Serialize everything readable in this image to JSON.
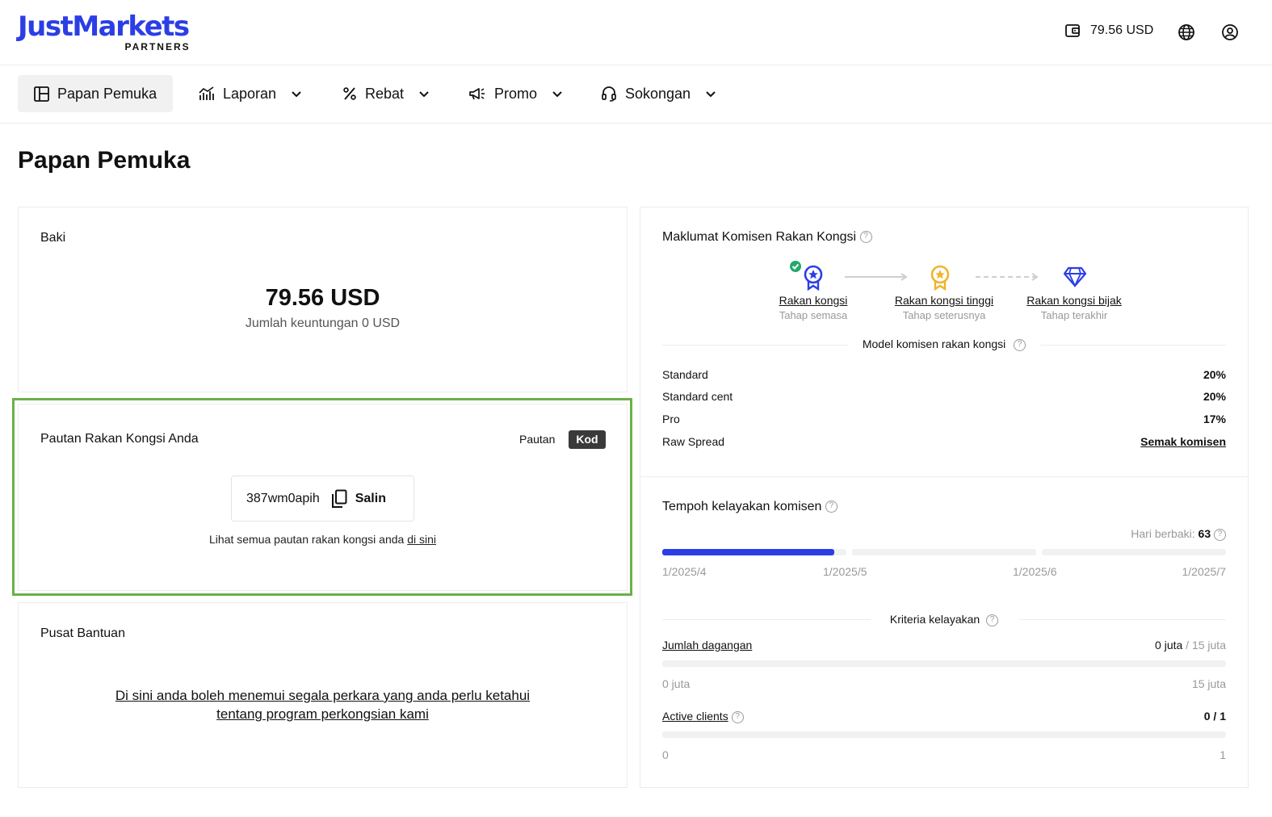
{
  "header": {
    "logo_main": "JustMarkets",
    "logo_sub": "PARTNERS",
    "wallet_balance": "79.56 USD",
    "icons": [
      "wallet-icon",
      "globe-icon",
      "user-icon"
    ]
  },
  "nav": {
    "items": [
      {
        "label": "Papan Pemuka",
        "icon": "dashboard-icon",
        "active": true
      },
      {
        "label": "Laporan",
        "icon": "chart-icon",
        "dropdown": true
      },
      {
        "label": "Rebat",
        "icon": "percent-icon",
        "dropdown": true
      },
      {
        "label": "Promo",
        "icon": "megaphone-icon",
        "dropdown": true
      },
      {
        "label": "Sokongan",
        "icon": "headset-icon",
        "dropdown": true
      }
    ]
  },
  "page_title": "Papan Pemuka",
  "balance": {
    "title": "Baki",
    "amount": "79.56 USD",
    "subtitle": "Jumlah keuntungan 0 USD"
  },
  "partner_link": {
    "title": "Pautan Rakan Kongsi Anda",
    "toggle_link": "Pautan",
    "toggle_code": "Kod",
    "code": "387wm0apih",
    "copy_label": "Salin",
    "see_all_text": "Lihat semua pautan rakan kongsi anda",
    "see_all_link": "di sini"
  },
  "help_center": {
    "title": "Pusat Bantuan",
    "line1": "Di sini anda boleh menemui segala perkara yang anda perlu ketahui",
    "line2": "tentang program perkongsian kami"
  },
  "commission_info": {
    "title": "Maklumat Komisen Rakan Kongsi",
    "tiers": [
      {
        "name": "Rakan kongsi",
        "stage": "Tahap semasa",
        "color": "#2b3ee6",
        "current": true
      },
      {
        "name": "Rakan kongsi tinggi",
        "stage": "Tahap seterusnya",
        "color": "#f0b429"
      },
      {
        "name": "Rakan kongsi bijak",
        "stage": "Tahap terakhir",
        "color": "#2b3ee6"
      }
    ],
    "model_title": "Model komisen rakan kongsi",
    "rates": [
      {
        "label": "Standard",
        "value": "20%"
      },
      {
        "label": "Standard cent",
        "value": "20%"
      },
      {
        "label": "Pro",
        "value": "17%"
      },
      {
        "label": "Raw Spread",
        "value": "Semak komisen"
      }
    ]
  },
  "eligibility": {
    "title": "Tempoh kelayakan komisen",
    "days_left_label": "Hari berbaki:",
    "days_left_value": "63",
    "progress_fraction": 0.305,
    "dates": [
      "1/2025/4",
      "1/2025/5",
      "1/2025/6",
      "1/2025/7"
    ],
    "criteria_title": "Kriteria kelayakan",
    "criteria": [
      {
        "label": "Jumlah dagangan",
        "current": "0 juta",
        "total": "/ 15 juta",
        "min": "0 juta",
        "max": "15 juta",
        "fraction": 0
      },
      {
        "label": "Active clients",
        "current": "0",
        "total": "/ 1",
        "min": "0",
        "max": "1",
        "fraction": 0
      }
    ]
  },
  "colors": {
    "brand": "#2b3ee6",
    "highlight_border": "#6db04a",
    "success": "#22a96b"
  }
}
